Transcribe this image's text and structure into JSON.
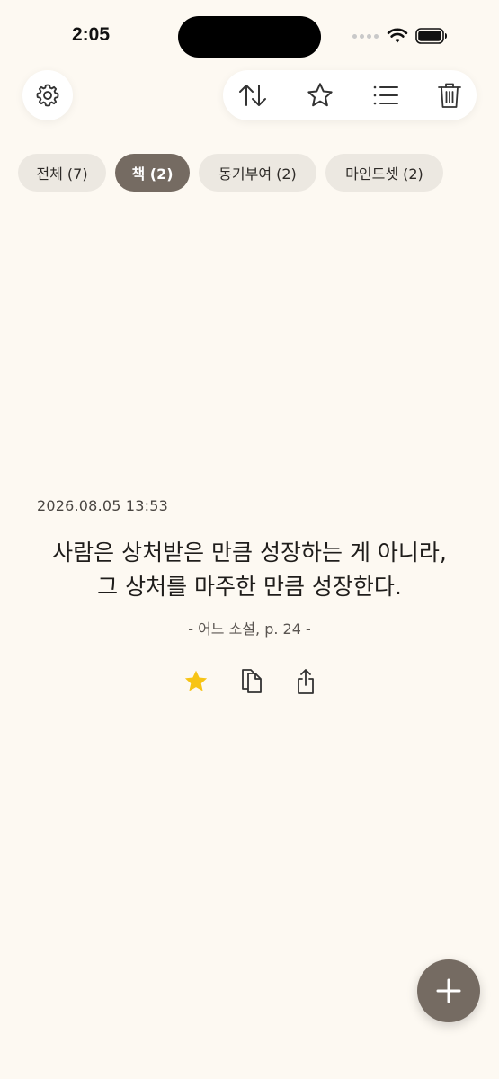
{
  "status_bar": {
    "time": "2:05"
  },
  "toolbar": {
    "settings_icon": "gear-icon",
    "sort_icon": "sort-arrows-icon",
    "favorite_icon": "star-outline-icon",
    "list_icon": "list-icon",
    "delete_icon": "trash-icon"
  },
  "categories": [
    {
      "label": "전체 (7)",
      "selected": false
    },
    {
      "label": "책 (2)",
      "selected": true
    },
    {
      "label": "동기부여 (2)",
      "selected": false
    },
    {
      "label": "마인드셋 (2)",
      "selected": false
    }
  ],
  "quote": {
    "date": "2026.08.05 13:53",
    "line1": "사람은 상처받은 만큼 성장하는 게 아니라,",
    "line2": "그 상처를 마주한 만큼 성장한다.",
    "source": "- 어느 소설, p. 24 -",
    "favorited": true
  },
  "card_actions": {
    "favorite_icon": "star-filled-icon",
    "copy_icon": "copy-icon",
    "share_icon": "share-icon"
  },
  "fab": {
    "icon": "plus-icon"
  },
  "colors": {
    "background": "#FDF9F2",
    "accent": "#756B62",
    "chip": "#ECE8E1",
    "star": "#F7C415"
  }
}
